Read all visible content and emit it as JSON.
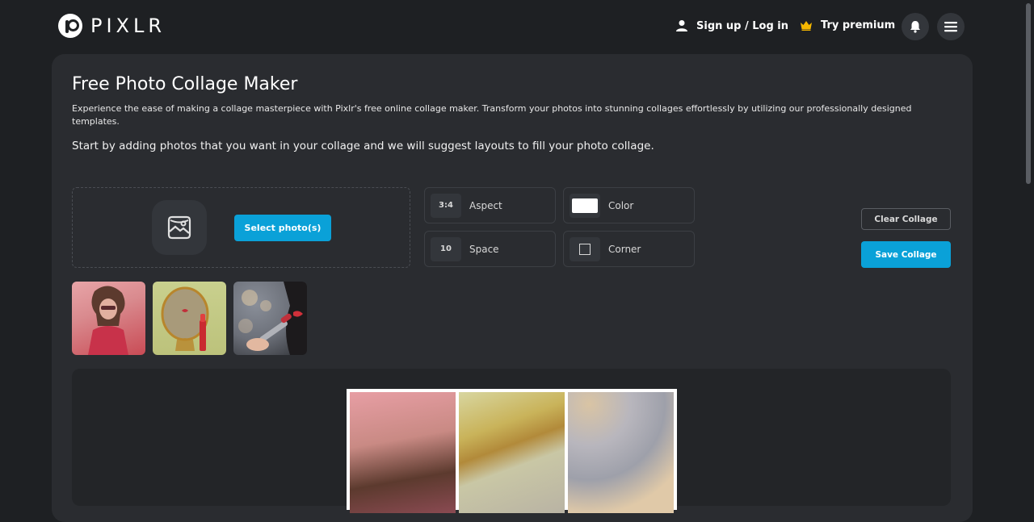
{
  "brand": {
    "name": "PIXLR"
  },
  "nav": {
    "signup_label": "Sign up / Log in",
    "premium_label": "Try premium",
    "premium_icon": "crown-icon",
    "premium_color": "#f5b700"
  },
  "page": {
    "title": "Free Photo Collage Maker",
    "intro": "Experience the ease of making a collage masterpiece with Pixlr's free online collage maker. Transform your photos into stunning collages effortlessly by utilizing our professionally designed templates.",
    "lead": "Start by adding photos that you want in your collage and we will suggest layouts to fill your photo collage."
  },
  "uploader": {
    "select_label": "Select photo(s)",
    "icon": "image-icon"
  },
  "options": {
    "aspect": {
      "value": "3:4",
      "label": "Aspect"
    },
    "color": {
      "value": "#ffffff",
      "label": "Color"
    },
    "space": {
      "value": "10",
      "label": "Space"
    },
    "corner": {
      "label": "Corner"
    }
  },
  "actions": {
    "clear_label": "Clear Collage",
    "save_label": "Save Collage"
  },
  "colors": {
    "accent": "#0aa1d8",
    "background": "#1e2023",
    "card": "#2a2c30"
  }
}
